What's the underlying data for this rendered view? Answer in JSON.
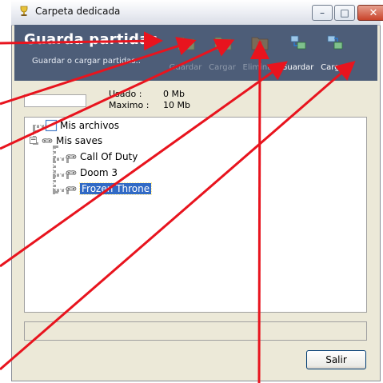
{
  "window": {
    "title": "Carpeta dedicada",
    "controls": {
      "minimize": "–",
      "maximize": "□",
      "close": "✕"
    }
  },
  "header": {
    "title": "Guarda partidas",
    "subtitle": "Guardar o cargar partidas..",
    "tools": [
      {
        "label": "Guardar",
        "icon": "save-folder-icon",
        "enabled": false
      },
      {
        "label": "Cargar",
        "icon": "load-folder-icon",
        "enabled": false
      },
      {
        "label": "Eliminar",
        "icon": "delete-folder-icon",
        "enabled": false
      },
      {
        "label": "Guardar",
        "icon": "save-network-icon",
        "enabled": true
      },
      {
        "label": "Cargar",
        "icon": "load-network-icon",
        "enabled": true
      }
    ]
  },
  "usage": {
    "used_label": "Usado :",
    "used_value": "0 Mb",
    "max_label": "Maximo :",
    "max_value": "10 Mb"
  },
  "tree": {
    "items": [
      {
        "label": "Mis archivos",
        "icon": "folder-icon"
      },
      {
        "label": "Mis saves",
        "icon": "gamepad-icon",
        "expander": "−"
      },
      {
        "label": "Call Of Duty",
        "icon": "gamepad-icon"
      },
      {
        "label": "Doom 3",
        "icon": "gamepad-icon"
      },
      {
        "label": "Frozen Throne",
        "icon": "gamepad-icon",
        "selected": true
      }
    ]
  },
  "footer": {
    "exit_label": "Salir"
  },
  "annotation": {
    "arrow_color": "#e8141e"
  }
}
